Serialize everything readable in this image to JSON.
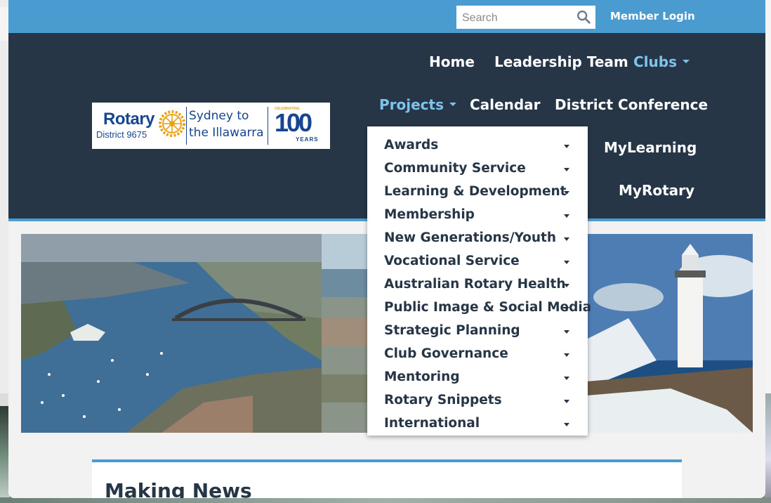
{
  "search": {
    "placeholder": "Search"
  },
  "member_login": "Member Login",
  "logo": {
    "name": "Rotary",
    "district": "District 9675",
    "tagline_1": "Sydney to",
    "tagline_2": "the Illawarra",
    "celebrating": "CELEBRATING",
    "hundred": "100",
    "years": "YEARS"
  },
  "nav": {
    "home": "Home",
    "leadership": "Leadership Team",
    "clubs": "Clubs",
    "projects": "Projects",
    "calendar": "Calendar",
    "conference": "District Conference",
    "mylearning": "MyLearning",
    "myrotary": "MyRotary"
  },
  "projects_menu": [
    "Awards",
    "Community Service",
    "Learning & Development",
    "Membership",
    "New Generations/Youth",
    "Vocational Service",
    "Australian Rotary Health",
    "Public Image & Social Media",
    "Strategic Planning",
    "Club Governance",
    "Mentoring",
    "Rotary Snippets",
    "International"
  ],
  "news": {
    "heading": "Making News"
  },
  "colors": {
    "topbar": "#4a9bd0",
    "header": "#263646",
    "active_nav": "#7ec3ec",
    "rotary_blue": "#17458f",
    "rotary_gold": "#e8a317"
  }
}
